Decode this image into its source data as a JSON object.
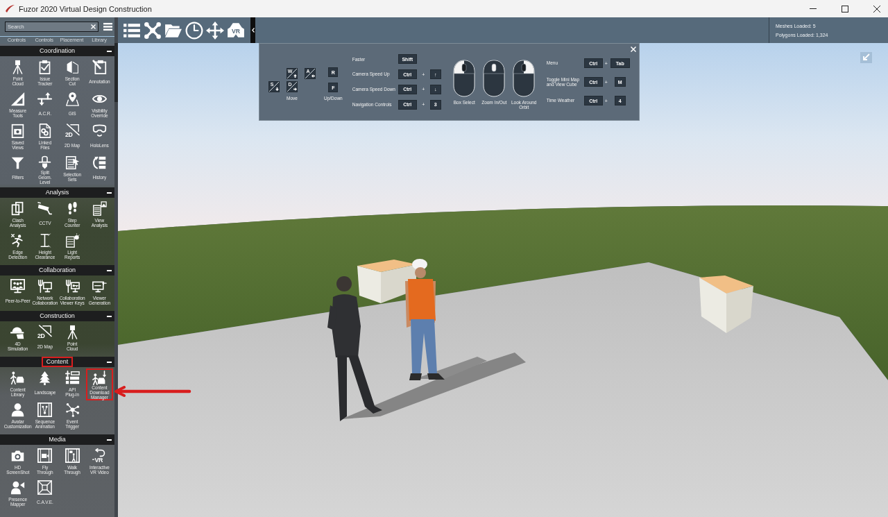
{
  "window": {
    "title": "Fuzor 2020 Virtual Design Construction"
  },
  "sidebar": {
    "search": {
      "placeholder": "Search"
    },
    "partial_row": [
      "Controls",
      "Controls",
      "Placement",
      "Library"
    ],
    "sections": [
      {
        "title": "Coordination",
        "expanded": true,
        "highlighted": false,
        "tools": [
          {
            "label": "Point Cloud",
            "highlighted": false
          },
          {
            "label": "Issue Tracker",
            "highlighted": false
          },
          {
            "label": "Section Cut",
            "highlighted": false
          },
          {
            "label": "Annotation",
            "highlighted": false
          },
          {
            "label": "Measure Tools",
            "highlighted": false
          },
          {
            "label": "A.C.R.",
            "highlighted": false
          },
          {
            "label": "GIS",
            "highlighted": false
          },
          {
            "label": "Visibility Override",
            "highlighted": false
          },
          {
            "label": "Saved Views",
            "highlighted": false
          },
          {
            "label": "Linked Files",
            "highlighted": false
          },
          {
            "label": "2D Map",
            "icon_text": "2D",
            "highlighted": false
          },
          {
            "label": "HoloLens",
            "highlighted": false
          },
          {
            "label": "Filters",
            "highlighted": false
          },
          {
            "label": "Split Geom. Level",
            "highlighted": false
          },
          {
            "label": "Selection Sets",
            "highlighted": false
          },
          {
            "label": "History",
            "highlighted": false
          }
        ]
      },
      {
        "title": "Analysis",
        "expanded": true,
        "highlighted": false,
        "tools": [
          {
            "label": "Clash Analysis",
            "highlighted": false
          },
          {
            "label": "CCTV",
            "highlighted": false
          },
          {
            "label": "Step Counter",
            "highlighted": false
          },
          {
            "label": "View Analysis",
            "highlighted": false
          },
          {
            "label": "Edge Detection",
            "highlighted": false
          },
          {
            "label": "Height Clearance",
            "highlighted": false
          },
          {
            "label": "Light Reports",
            "highlighted": false
          }
        ]
      },
      {
        "title": "Collaboration",
        "expanded": true,
        "highlighted": false,
        "tools": [
          {
            "label": "Peer-to-Peer",
            "highlighted": false
          },
          {
            "label": "Network Collaboration",
            "highlighted": false
          },
          {
            "label": "Collaboration Viewer Keys",
            "highlighted": false
          },
          {
            "label": "Viewer Generation",
            "highlighted": false
          }
        ]
      },
      {
        "title": "Construction",
        "expanded": true,
        "highlighted": false,
        "tools": [
          {
            "label": "4D Simulation",
            "highlighted": false
          },
          {
            "label": "2D Map",
            "icon_text": "2D",
            "highlighted": false
          },
          {
            "label": "Point Cloud",
            "highlighted": false
          }
        ]
      },
      {
        "title": "Content",
        "expanded": true,
        "highlighted": true,
        "tools": [
          {
            "label": "Content Library",
            "highlighted": false
          },
          {
            "label": "Landscape",
            "highlighted": false
          },
          {
            "label": "API Plug-In",
            "highlighted": false
          },
          {
            "label": "Content Download Manager",
            "highlighted": true
          },
          {
            "label": "Avatar Customization",
            "highlighted": false
          },
          {
            "label": "Sequence Animation",
            "highlighted": false
          },
          {
            "label": "Event Trigger",
            "highlighted": false
          }
        ]
      },
      {
        "title": "Media",
        "expanded": true,
        "highlighted": false,
        "tools": [
          {
            "label": "HD ScreenShot",
            "highlighted": false
          },
          {
            "label": "Fly Through",
            "highlighted": false
          },
          {
            "label": "Walk Through",
            "highlighted": false
          },
          {
            "label": "Interactive VR Video",
            "icon_text": "VR",
            "highlighted": false
          },
          {
            "label": "Presence Mapper",
            "highlighted": false
          },
          {
            "label": "C.A.V.E.",
            "highlighted": false
          }
        ]
      }
    ]
  },
  "toolbar": {
    "vr_icon_text": "VR"
  },
  "stats": [
    "Meshes Loaded: 5",
    "Polygons Loaded: 1,324"
  ],
  "controls_overlay": {
    "move_keys": [
      "W",
      "A",
      "S",
      "D"
    ],
    "move_label": "Move",
    "vertical_keys": [
      "R",
      "F"
    ],
    "vertical_label": "Up/Down",
    "shortcuts": [
      {
        "label": "Faster",
        "keys": [
          "Shift"
        ]
      },
      {
        "label": "Camera Speed Up",
        "keys": [
          "Ctrl",
          "↑"
        ],
        "joiner": "+"
      },
      {
        "label": "Camera Speed Down",
        "keys": [
          "Ctrl",
          "↓"
        ],
        "joiner": "+"
      },
      {
        "label": "Navigation Controls",
        "keys": [
          "Ctrl",
          "3"
        ],
        "joiner": "+"
      }
    ],
    "mouse_actions": [
      {
        "label": "Box Select",
        "kind": "left"
      },
      {
        "label": "Zoom In/Out",
        "kind": "wheel"
      },
      {
        "label": "Look Around Orbit",
        "kind": "right"
      }
    ],
    "menu_shortcuts": [
      {
        "label": "Menu",
        "keys": [
          "Ctrl",
          "Tab"
        ],
        "joiner": "+"
      },
      {
        "label": "Toggle Mini Map and View Cube",
        "keys": [
          "Ctrl",
          "M"
        ],
        "joiner": "+"
      },
      {
        "label": "Time Weather",
        "keys": [
          "Ctrl",
          "4"
        ],
        "joiner": "+"
      }
    ]
  }
}
